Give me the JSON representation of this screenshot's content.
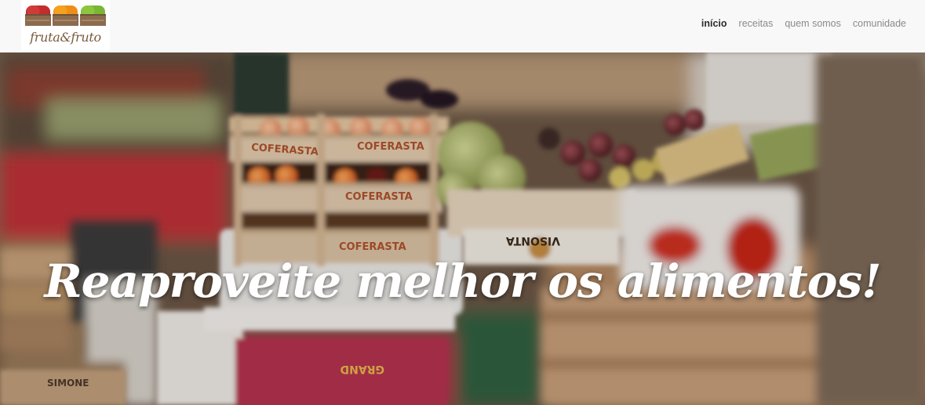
{
  "brand": {
    "name": "fruta&fruto"
  },
  "nav": {
    "items": [
      {
        "label": "início",
        "active": true
      },
      {
        "label": "receitas",
        "active": false
      },
      {
        "label": "quem somos",
        "active": false
      },
      {
        "label": "comunidade",
        "active": false
      }
    ]
  },
  "hero": {
    "headline": "Reaproveite melhor os alimentos!",
    "crate_labels": [
      "COFERASTA",
      "COFERASTA",
      "COFERASTA",
      "COFERASTA",
      "VISONTA",
      "SIMONE",
      "GRAND"
    ]
  },
  "colors": {
    "nav_background": "#f8f8f8",
    "nav_active": "#2b2b2b",
    "nav_inactive": "#8a8a8a",
    "headline": "#ffffff"
  }
}
